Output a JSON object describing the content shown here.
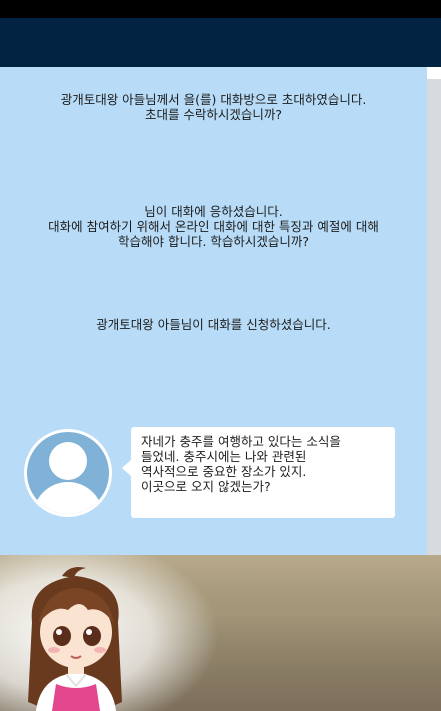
{
  "chat": {
    "invite_message": "광개토대왕 아들님께서 을(를) 대화방으로 초대하였습니다.\n초대를 수락하시겠습니까?",
    "accept_message": "님이 대화에 응하셨습니다.\n대화에 참여하기 위해서 온라인 대화에 대한 특징과 예절에 대해\n학습해야 합니다. 학습하시겠습니까?",
    "request_message": "광개토대왕 아들님이 대화를 신청하셨습니다.",
    "bubble_message": "자네가 충주를 여행하고 있다는 소식을\n들었네. 충주시에는 나와 관련된\n역사적으로 중요한 장소가 있지.\n이곳으로 오지 않겠는가?"
  },
  "colors": {
    "title_bar": "#022341",
    "chat_background": "#b8dcf7",
    "avatar_fill": "#7fb2d6"
  },
  "icons": {
    "avatar": "default-user-avatar-icon",
    "character": "girl-character-illustration"
  }
}
